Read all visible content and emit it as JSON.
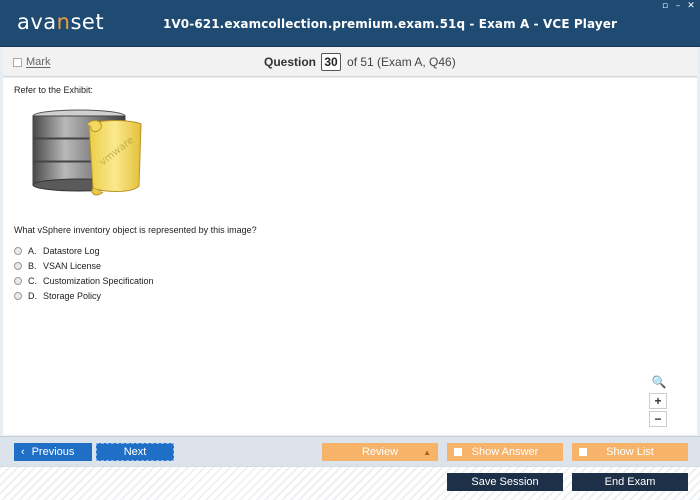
{
  "titlebar": {
    "logo": {
      "part1": "ava",
      "accent": "n",
      "part2": "set"
    },
    "title": "1V0-621.examcollection.premium.exam.51q - Exam A - VCE Player",
    "controls": [
      "▫",
      "–",
      "✕"
    ]
  },
  "header": {
    "mark_label": "Mark",
    "question_label": "Question",
    "question_number": "30",
    "question_of": "of 51 (Exam A, Q46)"
  },
  "content": {
    "refer": "Refer to the Exhibit:",
    "exhibit_icon": "datastore-log-icon",
    "exhibit_watermark": "vmware",
    "question": "What vSphere inventory object is represented by this image?",
    "options": [
      {
        "letter": "A.",
        "text": "Datastore Log"
      },
      {
        "letter": "B.",
        "text": "VSAN License"
      },
      {
        "letter": "C.",
        "text": "Customization Specification"
      },
      {
        "letter": "D.",
        "text": "Storage Policy"
      }
    ],
    "zoom": {
      "search_icon": "🔍",
      "plus": "+",
      "minus": "−"
    }
  },
  "nav": {
    "previous": "Previous",
    "next": "Next",
    "review": "Review",
    "show_answer": "Show Answer",
    "show_list": "Show List",
    "prev_icon": "‹",
    "review_icon": "▲"
  },
  "footer": {
    "save_session": "Save Session",
    "end_exam": "End Exam"
  },
  "colors": {
    "titlebar": "#1f4b73",
    "accent": "#f39c3a",
    "nav_blue": "#1f6fc6",
    "nav_orange": "#f7b36a",
    "footer_dark": "#1d3047"
  }
}
